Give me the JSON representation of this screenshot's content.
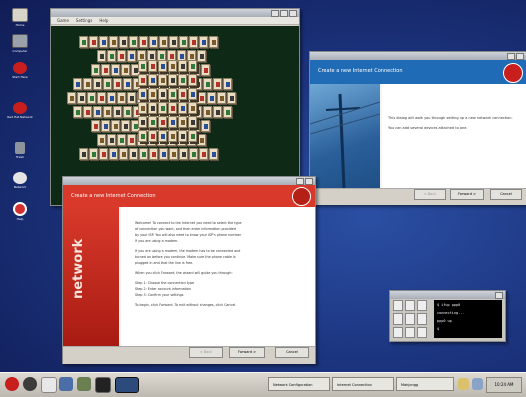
{
  "desktop": {
    "icons": [
      {
        "name": "home",
        "label": "Home"
      },
      {
        "name": "computer",
        "label": "Computer"
      },
      {
        "name": "start-here",
        "label": "Start Here"
      },
      {
        "name": "red-hat-network",
        "label": "Red Hat Network"
      },
      {
        "name": "trash",
        "label": "Trash"
      },
      {
        "name": "network",
        "label": "Network"
      },
      {
        "name": "help",
        "label": "Help"
      }
    ]
  },
  "mahjong": {
    "menu": [
      "Game",
      "Settings",
      "Help"
    ]
  },
  "druid": {
    "title": "Create a new Internet Connection",
    "body": [
      "This dialog will walk you through setting up a new network connection.",
      "You can add several devices attached to one."
    ],
    "buttons": {
      "back": "< Back",
      "next": "Forward >",
      "cancel": "Cancel"
    }
  },
  "connection": {
    "title": "Create a new Internet Connection",
    "brand": "network",
    "body": [
      "Welcome! To connect to the Internet you need to select the type",
      "of connection you want, and then enter information provided",
      "by your ISP. You will also need to know your ISP's phone number",
      "if you are using a modem.",
      "",
      "If you are using a modem, the modem has to be connected and",
      "turned on before you continue. Make sure the phone cable is",
      "plugged in and that the line is free.",
      "",
      "When you click Forward, the wizard will guide you through:",
      "",
      "Step 1: Choose the connection type",
      "Step 2: Enter account information",
      "Step 3: Confirm your settings",
      "",
      "To begin, click Forward. To exit without changes, click Cancel."
    ],
    "buttons": {
      "back": "< Back",
      "next": "Forward >",
      "cancel": "Cancel"
    }
  },
  "terminal": {
    "lines": [
      "$ ifup ppp0",
      "connecting...",
      "ppp0 up",
      "$"
    ]
  },
  "taskbar": {
    "launchers": [
      "red-hat-menu",
      "browser",
      "mail",
      "office",
      "file-manager",
      "terminal"
    ],
    "tasks": [
      "Network Configuration",
      "Internet Connection",
      "Mahjongg"
    ],
    "clock": "10:24 AM"
  },
  "colors": {
    "desktop": "#1c3580",
    "druid_banner": "#1f6bb5",
    "connection_banner": "#d8392a",
    "board": "#0e2a17"
  }
}
